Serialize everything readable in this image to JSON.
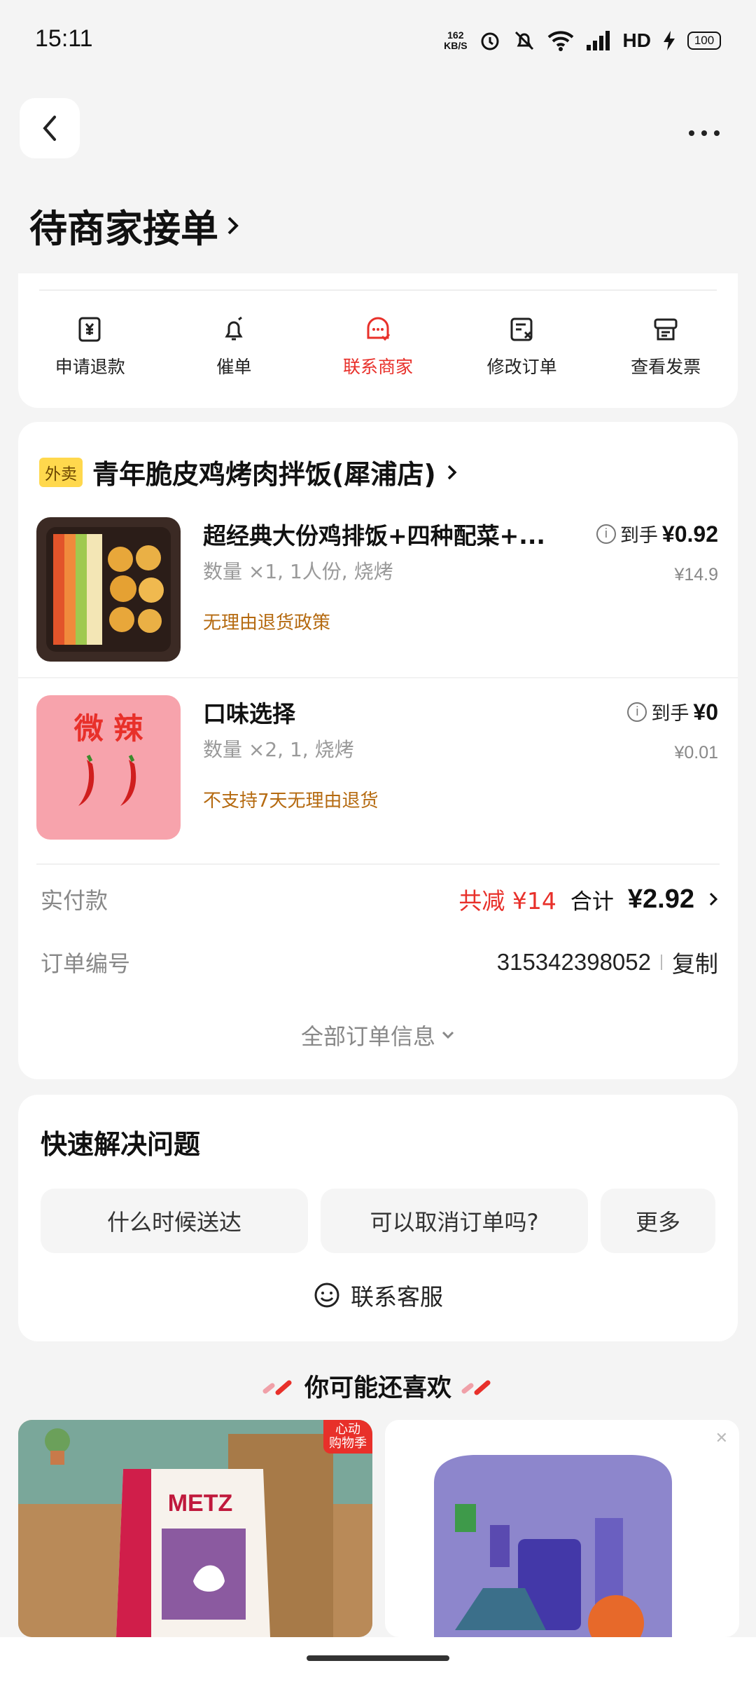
{
  "status_bar": {
    "time": "15:11",
    "net_speed_value": "162",
    "net_speed_unit": "KB/S",
    "network": "HD",
    "battery": "100"
  },
  "header": {
    "title": "待商家接单"
  },
  "actions": [
    {
      "label": "申请退款",
      "icon": "refund-icon"
    },
    {
      "label": "催单",
      "icon": "bell-icon"
    },
    {
      "label": "联系商家",
      "icon": "merchant-chat-icon",
      "active": true
    },
    {
      "label": "修改订单",
      "icon": "edit-order-icon"
    },
    {
      "label": "查看发票",
      "icon": "invoice-icon"
    }
  ],
  "order": {
    "store_badge": "外卖",
    "store_name": "青年脆皮鸡烤肉拌饭(犀浦店)",
    "items": [
      {
        "name": "超经典大份鸡排饭+四种配菜+...",
        "specs": "数量 ×1, 1人份, 烧烤",
        "policy": "无理由退货政策",
        "price_label": "到手",
        "price": "¥0.92",
        "original_price": "¥14.9"
      },
      {
        "name": "口味选择",
        "specs": "数量 ×2, 1, 烧烤",
        "policy": "不支持7天无理由退货",
        "price_label": "到手",
        "price": "¥0",
        "original_price": "¥0.01",
        "thumb_text": "微   辣"
      }
    ],
    "paid_label": "实付款",
    "discount": "共减 ¥14",
    "total_label": "合计",
    "total": "¥2.92",
    "order_no_label": "订单编号",
    "order_no": "315342398052",
    "copy_label": "复制",
    "all_info_label": "全部订单信息"
  },
  "help": {
    "title": "快速解决问题",
    "chips": [
      "什么时候送达",
      "可以取消订单吗?",
      "更多"
    ],
    "service_label": "联系客服"
  },
  "recommend": {
    "title": "你可能还喜欢",
    "card1_badge": "心动\n购物季",
    "card1_brand": "METZ"
  },
  "colors": {
    "accent": "#e8302a",
    "policy": "#b56a10",
    "badge": "#ffd84d"
  }
}
